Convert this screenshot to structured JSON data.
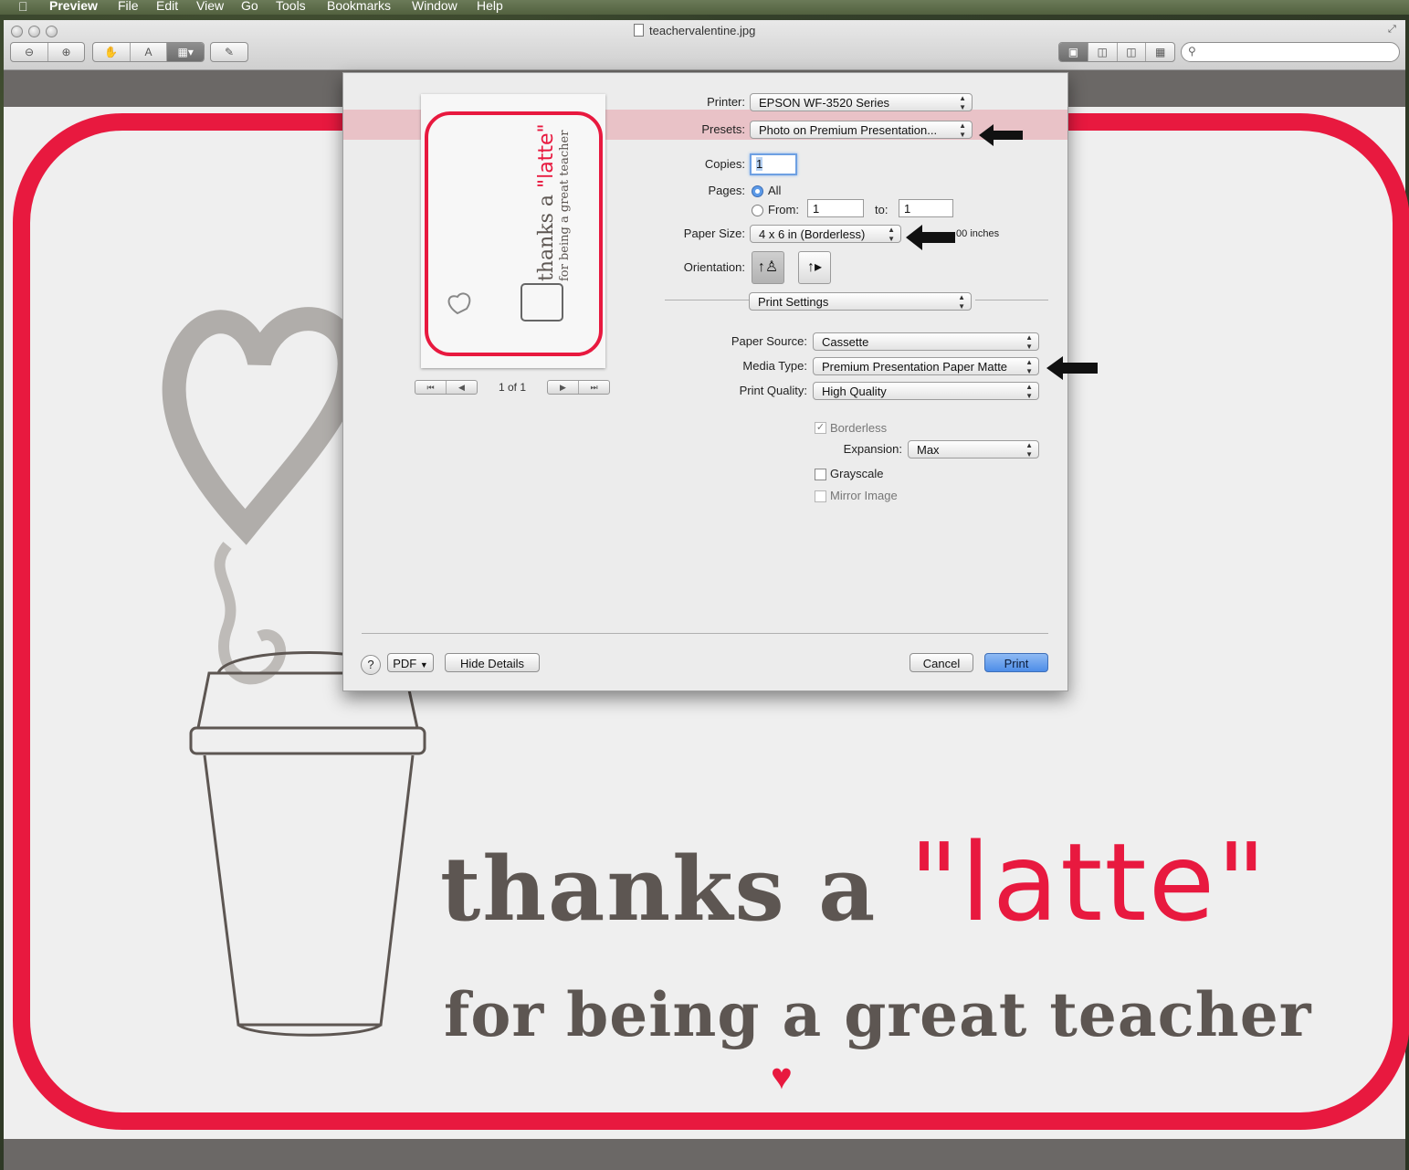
{
  "menubar": {
    "app": "Preview",
    "items": [
      "File",
      "Edit",
      "View",
      "Go",
      "Tools",
      "Bookmarks",
      "Window",
      "Help"
    ]
  },
  "window": {
    "title": "teachervalentine.jpg"
  },
  "document": {
    "line1": "thanks a ",
    "latte": "\"latte\"",
    "line2": "for being a great teacher"
  },
  "print": {
    "printer_label": "Printer:",
    "printer_value": "EPSON WF-3520 Series",
    "presets_label": "Presets:",
    "presets_value": "Photo on Premium Presentation...",
    "copies_label": "Copies:",
    "copies_value": "1",
    "pages_label": "Pages:",
    "pages_all": "All",
    "pages_from": "From:",
    "pages_from_value": "1",
    "pages_to": "to:",
    "pages_to_value": "1",
    "paper_size_label": "Paper Size:",
    "paper_size_value": "4 x 6 in (Borderless)",
    "paper_size_dims": ".00 inches",
    "orientation_label": "Orientation:",
    "section_value": "Print Settings",
    "paper_source_label": "Paper Source:",
    "paper_source_value": "Cassette",
    "media_type_label": "Media Type:",
    "media_type_value": "Premium Presentation Paper Matte",
    "print_quality_label": "Print Quality:",
    "print_quality_value": "High Quality",
    "borderless": "Borderless",
    "expansion_label": "Expansion:",
    "expansion_value": "Max",
    "grayscale": "Grayscale",
    "mirror_image": "Mirror Image",
    "page_indicator": "1 of 1",
    "help": "?",
    "pdf": "PDF",
    "hide_details": "Hide Details",
    "cancel": "Cancel",
    "print": "Print"
  },
  "colors": {
    "accent_red": "#e8193f",
    "print_blue": "#4d8de8"
  }
}
